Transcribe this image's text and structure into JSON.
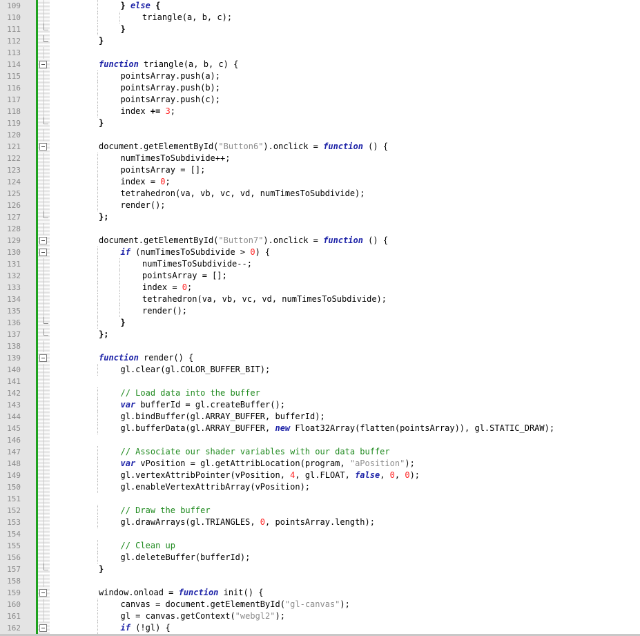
{
  "editor": {
    "language": "javascript",
    "colors": {
      "gutter_bg": "#e4e4e4",
      "line_number": "#8a8a8a",
      "change_marker": "#1fa21f",
      "keyword": "#1e24a8",
      "string": "#8c8c8c",
      "number": "#ff2222",
      "comment": "#1f8a1f"
    }
  },
  "lines": [
    {
      "n": "109",
      "indent": 3,
      "fold": "line",
      "tokens": [
        {
          "t": "} ",
          "c": "op"
        },
        {
          "t": "else",
          "c": "kw"
        },
        {
          "t": " {",
          "c": "op"
        }
      ]
    },
    {
      "n": "110",
      "indent": 4,
      "fold": "line",
      "tokens": [
        {
          "t": "triangle(a, b, c);",
          "c": "id"
        }
      ]
    },
    {
      "n": "111",
      "indent": 3,
      "fold": "end",
      "tokens": [
        {
          "t": "}",
          "c": "op"
        }
      ]
    },
    {
      "n": "112",
      "indent": 2,
      "fold": "end",
      "tokens": [
        {
          "t": "}",
          "c": "op"
        }
      ]
    },
    {
      "n": "113",
      "indent": 0,
      "fold": "line",
      "tokens": []
    },
    {
      "n": "114",
      "indent": 2,
      "fold": "box",
      "tokens": [
        {
          "t": "function",
          "c": "kw"
        },
        {
          "t": " triangle(a, b, c) {",
          "c": "id"
        }
      ]
    },
    {
      "n": "115",
      "indent": 3,
      "fold": "line",
      "tokens": [
        {
          "t": "pointsArray.push(a);",
          "c": "id"
        }
      ]
    },
    {
      "n": "116",
      "indent": 3,
      "fold": "line",
      "tokens": [
        {
          "t": "pointsArray.push(b);",
          "c": "id"
        }
      ]
    },
    {
      "n": "117",
      "indent": 3,
      "fold": "line",
      "tokens": [
        {
          "t": "pointsArray.push(c);",
          "c": "id"
        }
      ]
    },
    {
      "n": "118",
      "indent": 3,
      "fold": "line",
      "tokens": [
        {
          "t": "index ",
          "c": "id"
        },
        {
          "t": "+=",
          "c": "op"
        },
        {
          "t": " ",
          "c": "id"
        },
        {
          "t": "3",
          "c": "num"
        },
        {
          "t": ";",
          "c": "id"
        }
      ]
    },
    {
      "n": "119",
      "indent": 2,
      "fold": "end",
      "tokens": [
        {
          "t": "}",
          "c": "op"
        }
      ]
    },
    {
      "n": "120",
      "indent": 0,
      "fold": "line",
      "tokens": []
    },
    {
      "n": "121",
      "indent": 2,
      "fold": "box",
      "tokens": [
        {
          "t": "document.getElementById(",
          "c": "id"
        },
        {
          "t": "\"Button6\"",
          "c": "str"
        },
        {
          "t": ").onclick = ",
          "c": "id"
        },
        {
          "t": "function",
          "c": "kw"
        },
        {
          "t": " () {",
          "c": "id"
        }
      ]
    },
    {
      "n": "122",
      "indent": 3,
      "fold": "line",
      "tokens": [
        {
          "t": "numTimesToSubdivide++;",
          "c": "id"
        }
      ]
    },
    {
      "n": "123",
      "indent": 3,
      "fold": "line",
      "tokens": [
        {
          "t": "pointsArray = [];",
          "c": "id"
        }
      ]
    },
    {
      "n": "124",
      "indent": 3,
      "fold": "line",
      "tokens": [
        {
          "t": "index = ",
          "c": "id"
        },
        {
          "t": "0",
          "c": "num"
        },
        {
          "t": ";",
          "c": "id"
        }
      ]
    },
    {
      "n": "125",
      "indent": 3,
      "fold": "line",
      "tokens": [
        {
          "t": "tetrahedron(va, vb, vc, vd, numTimesToSubdivide);",
          "c": "id"
        }
      ]
    },
    {
      "n": "126",
      "indent": 3,
      "fold": "line",
      "tokens": [
        {
          "t": "render();",
          "c": "id"
        }
      ]
    },
    {
      "n": "127",
      "indent": 2,
      "fold": "end",
      "tokens": [
        {
          "t": "};",
          "c": "op"
        }
      ]
    },
    {
      "n": "128",
      "indent": 0,
      "fold": "line",
      "tokens": []
    },
    {
      "n": "129",
      "indent": 2,
      "fold": "box",
      "tokens": [
        {
          "t": "document.getElementById(",
          "c": "id"
        },
        {
          "t": "\"Button7\"",
          "c": "str"
        },
        {
          "t": ").onclick = ",
          "c": "id"
        },
        {
          "t": "function",
          "c": "kw"
        },
        {
          "t": " () {",
          "c": "id"
        }
      ]
    },
    {
      "n": "130",
      "indent": 3,
      "fold": "box",
      "tokens": [
        {
          "t": "if",
          "c": "kw"
        },
        {
          "t": " (numTimesToSubdivide > ",
          "c": "id"
        },
        {
          "t": "0",
          "c": "num"
        },
        {
          "t": ") {",
          "c": "id"
        }
      ]
    },
    {
      "n": "131",
      "indent": 4,
      "fold": "line",
      "tokens": [
        {
          "t": "numTimesToSubdivide--;",
          "c": "id"
        }
      ]
    },
    {
      "n": "132",
      "indent": 4,
      "fold": "line",
      "tokens": [
        {
          "t": "pointsArray = [];",
          "c": "id"
        }
      ]
    },
    {
      "n": "133",
      "indent": 4,
      "fold": "line",
      "tokens": [
        {
          "t": "index = ",
          "c": "id"
        },
        {
          "t": "0",
          "c": "num"
        },
        {
          "t": ";",
          "c": "id"
        }
      ]
    },
    {
      "n": "134",
      "indent": 4,
      "fold": "line",
      "tokens": [
        {
          "t": "tetrahedron(va, vb, vc, vd, numTimesToSubdivide);",
          "c": "id"
        }
      ]
    },
    {
      "n": "135",
      "indent": 4,
      "fold": "line",
      "tokens": [
        {
          "t": "render();",
          "c": "id"
        }
      ]
    },
    {
      "n": "136",
      "indent": 3,
      "fold": "end",
      "tokens": [
        {
          "t": "}",
          "c": "op"
        }
      ]
    },
    {
      "n": "137",
      "indent": 2,
      "fold": "end",
      "tokens": [
        {
          "t": "};",
          "c": "op"
        }
      ]
    },
    {
      "n": "138",
      "indent": 0,
      "fold": "line",
      "tokens": []
    },
    {
      "n": "139",
      "indent": 2,
      "fold": "box",
      "tokens": [
        {
          "t": "function",
          "c": "kw"
        },
        {
          "t": " render() {",
          "c": "id"
        }
      ]
    },
    {
      "n": "140",
      "indent": 3,
      "fold": "line",
      "tokens": [
        {
          "t": "gl.clear(gl.COLOR_BUFFER_BIT);",
          "c": "id"
        }
      ]
    },
    {
      "n": "141",
      "indent": 0,
      "fold": "line",
      "tokens": []
    },
    {
      "n": "142",
      "indent": 3,
      "fold": "line",
      "tokens": [
        {
          "t": "// Load data into the buffer",
          "c": "cm"
        }
      ]
    },
    {
      "n": "143",
      "indent": 3,
      "fold": "line",
      "tokens": [
        {
          "t": "var",
          "c": "kw"
        },
        {
          "t": " bufferId = gl.createBuffer();",
          "c": "id"
        }
      ]
    },
    {
      "n": "144",
      "indent": 3,
      "fold": "line",
      "tokens": [
        {
          "t": "gl.bindBuffer(gl.ARRAY_BUFFER, bufferId);",
          "c": "id"
        }
      ]
    },
    {
      "n": "145",
      "indent": 3,
      "fold": "line",
      "tokens": [
        {
          "t": "gl.bufferData(gl.ARRAY_BUFFER, ",
          "c": "id"
        },
        {
          "t": "new",
          "c": "kw"
        },
        {
          "t": " Float32Array(flatten(pointsArray)), gl.STATIC_DRAW);",
          "c": "id"
        }
      ]
    },
    {
      "n": "146",
      "indent": 0,
      "fold": "line",
      "tokens": []
    },
    {
      "n": "147",
      "indent": 3,
      "fold": "line",
      "tokens": [
        {
          "t": "// Associate our shader variables with our data buffer",
          "c": "cm"
        }
      ]
    },
    {
      "n": "148",
      "indent": 3,
      "fold": "line",
      "tokens": [
        {
          "t": "var",
          "c": "kw"
        },
        {
          "t": " vPosition = gl.getAttribLocation(program, ",
          "c": "id"
        },
        {
          "t": "\"aPosition\"",
          "c": "str"
        },
        {
          "t": ");",
          "c": "id"
        }
      ]
    },
    {
      "n": "149",
      "indent": 3,
      "fold": "line",
      "tokens": [
        {
          "t": "gl.vertexAttribPointer(vPosition, ",
          "c": "id"
        },
        {
          "t": "4",
          "c": "num"
        },
        {
          "t": ", gl.FLOAT, ",
          "c": "id"
        },
        {
          "t": "false",
          "c": "kw"
        },
        {
          "t": ", ",
          "c": "id"
        },
        {
          "t": "0",
          "c": "num"
        },
        {
          "t": ", ",
          "c": "id"
        },
        {
          "t": "0",
          "c": "num"
        },
        {
          "t": ");",
          "c": "id"
        }
      ]
    },
    {
      "n": "150",
      "indent": 3,
      "fold": "line",
      "tokens": [
        {
          "t": "gl.enableVertexAttribArray(vPosition);",
          "c": "id"
        }
      ]
    },
    {
      "n": "151",
      "indent": 0,
      "fold": "line",
      "tokens": []
    },
    {
      "n": "152",
      "indent": 3,
      "fold": "line",
      "tokens": [
        {
          "t": "// Draw the buffer",
          "c": "cm"
        }
      ]
    },
    {
      "n": "153",
      "indent": 3,
      "fold": "line",
      "tokens": [
        {
          "t": "gl.drawArrays(gl.TRIANGLES, ",
          "c": "id"
        },
        {
          "t": "0",
          "c": "num"
        },
        {
          "t": ", pointsArray.length);",
          "c": "id"
        }
      ]
    },
    {
      "n": "154",
      "indent": 0,
      "fold": "line",
      "tokens": []
    },
    {
      "n": "155",
      "indent": 3,
      "fold": "line",
      "tokens": [
        {
          "t": "// Clean up",
          "c": "cm"
        }
      ]
    },
    {
      "n": "156",
      "indent": 3,
      "fold": "line",
      "tokens": [
        {
          "t": "gl.deleteBuffer(bufferId);",
          "c": "id"
        }
      ]
    },
    {
      "n": "157",
      "indent": 2,
      "fold": "end",
      "tokens": [
        {
          "t": "}",
          "c": "op"
        }
      ]
    },
    {
      "n": "158",
      "indent": 0,
      "fold": "line",
      "tokens": []
    },
    {
      "n": "159",
      "indent": 2,
      "fold": "box",
      "tokens": [
        {
          "t": "window.onload = ",
          "c": "id"
        },
        {
          "t": "function",
          "c": "kw"
        },
        {
          "t": " init() {",
          "c": "id"
        }
      ]
    },
    {
      "n": "160",
      "indent": 3,
      "fold": "line",
      "tokens": [
        {
          "t": "canvas = document.getElementById(",
          "c": "id"
        },
        {
          "t": "\"gl-canvas\"",
          "c": "str"
        },
        {
          "t": ");",
          "c": "id"
        }
      ]
    },
    {
      "n": "161",
      "indent": 3,
      "fold": "line",
      "tokens": [
        {
          "t": "gl = canvas.getContext(",
          "c": "id"
        },
        {
          "t": "\"webgl2\"",
          "c": "str"
        },
        {
          "t": ");",
          "c": "id"
        }
      ]
    },
    {
      "n": "162",
      "indent": 3,
      "fold": "box",
      "tokens": [
        {
          "t": "if",
          "c": "kw"
        },
        {
          "t": " (!gl) {",
          "c": "id"
        }
      ]
    }
  ]
}
